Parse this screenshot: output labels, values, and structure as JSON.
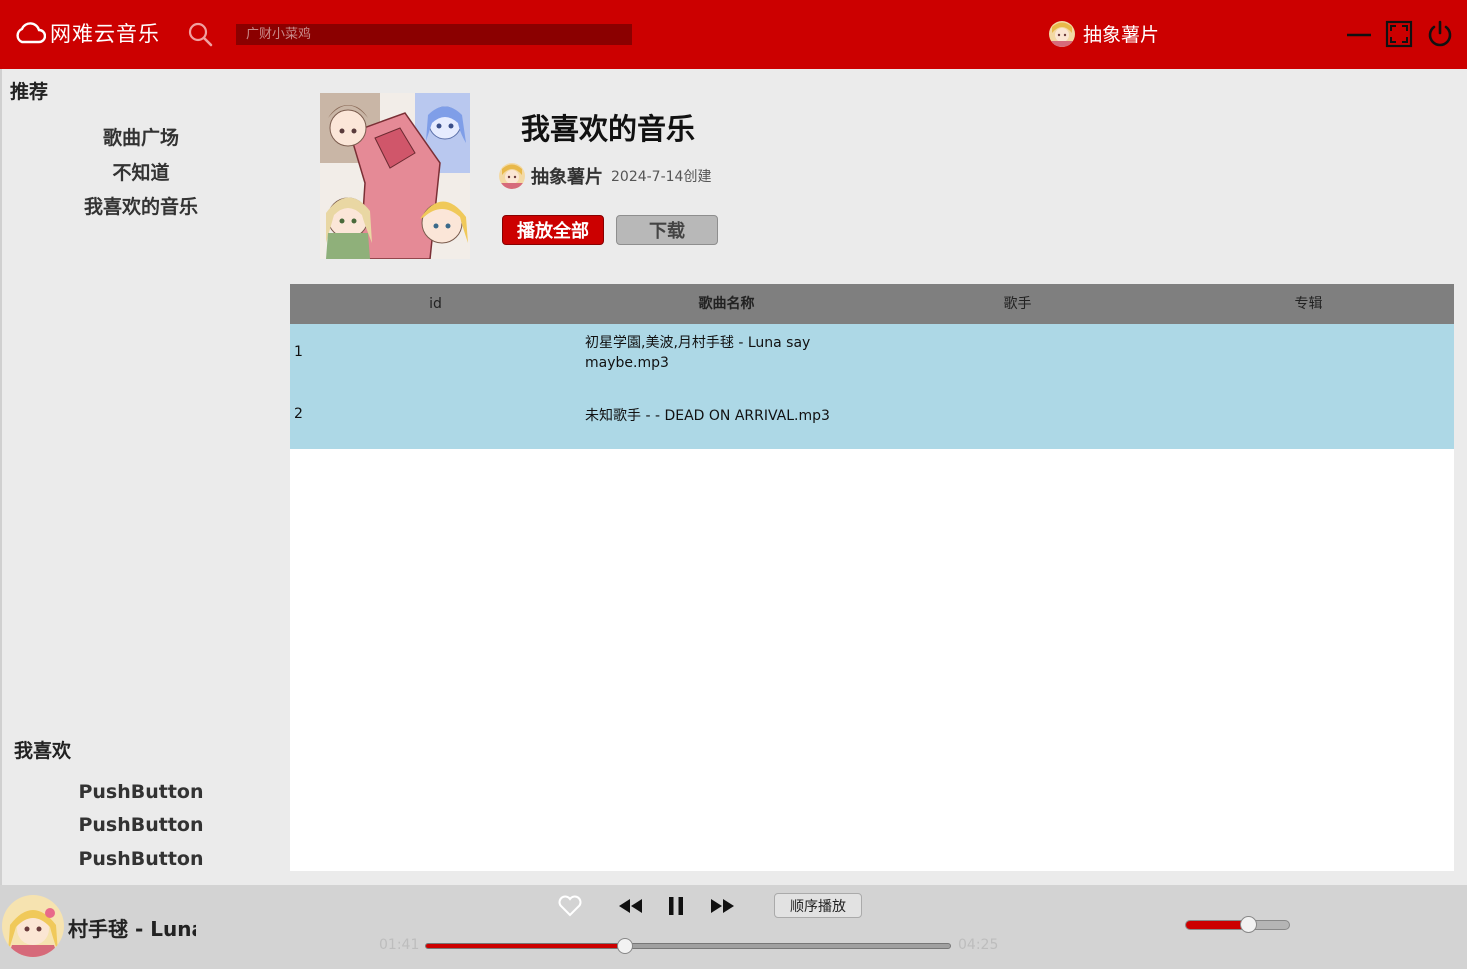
{
  "app": {
    "name": "网难云音乐",
    "search_placeholder": "广财小菜鸡",
    "user_name": "抽象薯片"
  },
  "colors": {
    "brand": "#cc0000",
    "search_bg": "#8b0000",
    "table_header": "#7f7f7f",
    "row_highlight": "#add8e6"
  },
  "icons": {
    "logo": "cloud-icon",
    "search": "search-icon",
    "minimize": "minimize-icon",
    "maximize": "maximize-icon",
    "close": "power-icon",
    "like": "heart-icon",
    "prev": "rewind-icon",
    "pause": "pause-icon",
    "next": "fast-forward-icon"
  },
  "sidebar": {
    "recommend_title": "推荐",
    "recommend_items": [
      {
        "label": "歌曲广场"
      },
      {
        "label": "不知道"
      },
      {
        "label": "我喜欢的音乐"
      }
    ],
    "likes_title": "我喜欢",
    "likes_items": [
      {
        "label": "PushButton"
      },
      {
        "label": "PushButton"
      },
      {
        "label": "PushButton"
      }
    ]
  },
  "playlist": {
    "title": "我喜欢的音乐",
    "owner": "抽象薯片",
    "created": "2024-7-14创建",
    "play_all_label": "播放全部",
    "download_label": "下载"
  },
  "table": {
    "columns": [
      "id",
      "歌曲名称",
      "歌手",
      "专辑"
    ],
    "rows": [
      {
        "id": "1",
        "name": "初星学園,美波,月村手毬 - Luna say maybe.mp3",
        "artist": "",
        "album": ""
      },
      {
        "id": "2",
        "name": "未知歌手 - - DEAD ON ARRIVAL.mp3",
        "artist": "",
        "album": ""
      }
    ]
  },
  "player": {
    "now_playing": "村手毬 - Luna",
    "mode_label": "顺序播放",
    "current_time": "01:41",
    "total_time": "04:25",
    "progress_fraction": 0.38,
    "volume_fraction": 0.6
  }
}
